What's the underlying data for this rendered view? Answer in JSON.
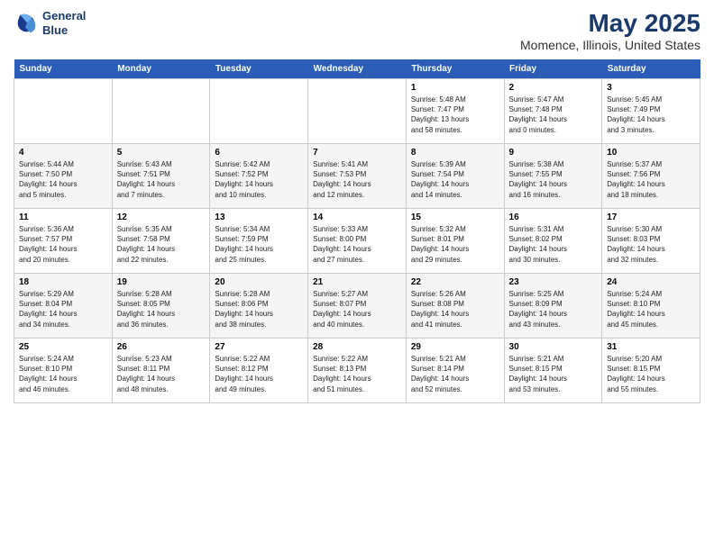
{
  "logo": {
    "line1": "General",
    "line2": "Blue"
  },
  "title": "May 2025",
  "subtitle": "Momence, Illinois, United States",
  "days_header": [
    "Sunday",
    "Monday",
    "Tuesday",
    "Wednesday",
    "Thursday",
    "Friday",
    "Saturday"
  ],
  "weeks": [
    [
      {
        "num": "",
        "info": ""
      },
      {
        "num": "",
        "info": ""
      },
      {
        "num": "",
        "info": ""
      },
      {
        "num": "",
        "info": ""
      },
      {
        "num": "1",
        "info": "Sunrise: 5:48 AM\nSunset: 7:47 PM\nDaylight: 13 hours\nand 58 minutes."
      },
      {
        "num": "2",
        "info": "Sunrise: 5:47 AM\nSunset: 7:48 PM\nDaylight: 14 hours\nand 0 minutes."
      },
      {
        "num": "3",
        "info": "Sunrise: 5:45 AM\nSunset: 7:49 PM\nDaylight: 14 hours\nand 3 minutes."
      }
    ],
    [
      {
        "num": "4",
        "info": "Sunrise: 5:44 AM\nSunset: 7:50 PM\nDaylight: 14 hours\nand 5 minutes."
      },
      {
        "num": "5",
        "info": "Sunrise: 5:43 AM\nSunset: 7:51 PM\nDaylight: 14 hours\nand 7 minutes."
      },
      {
        "num": "6",
        "info": "Sunrise: 5:42 AM\nSunset: 7:52 PM\nDaylight: 14 hours\nand 10 minutes."
      },
      {
        "num": "7",
        "info": "Sunrise: 5:41 AM\nSunset: 7:53 PM\nDaylight: 14 hours\nand 12 minutes."
      },
      {
        "num": "8",
        "info": "Sunrise: 5:39 AM\nSunset: 7:54 PM\nDaylight: 14 hours\nand 14 minutes."
      },
      {
        "num": "9",
        "info": "Sunrise: 5:38 AM\nSunset: 7:55 PM\nDaylight: 14 hours\nand 16 minutes."
      },
      {
        "num": "10",
        "info": "Sunrise: 5:37 AM\nSunset: 7:56 PM\nDaylight: 14 hours\nand 18 minutes."
      }
    ],
    [
      {
        "num": "11",
        "info": "Sunrise: 5:36 AM\nSunset: 7:57 PM\nDaylight: 14 hours\nand 20 minutes."
      },
      {
        "num": "12",
        "info": "Sunrise: 5:35 AM\nSunset: 7:58 PM\nDaylight: 14 hours\nand 22 minutes."
      },
      {
        "num": "13",
        "info": "Sunrise: 5:34 AM\nSunset: 7:59 PM\nDaylight: 14 hours\nand 25 minutes."
      },
      {
        "num": "14",
        "info": "Sunrise: 5:33 AM\nSunset: 8:00 PM\nDaylight: 14 hours\nand 27 minutes."
      },
      {
        "num": "15",
        "info": "Sunrise: 5:32 AM\nSunset: 8:01 PM\nDaylight: 14 hours\nand 29 minutes."
      },
      {
        "num": "16",
        "info": "Sunrise: 5:31 AM\nSunset: 8:02 PM\nDaylight: 14 hours\nand 30 minutes."
      },
      {
        "num": "17",
        "info": "Sunrise: 5:30 AM\nSunset: 8:03 PM\nDaylight: 14 hours\nand 32 minutes."
      }
    ],
    [
      {
        "num": "18",
        "info": "Sunrise: 5:29 AM\nSunset: 8:04 PM\nDaylight: 14 hours\nand 34 minutes."
      },
      {
        "num": "19",
        "info": "Sunrise: 5:28 AM\nSunset: 8:05 PM\nDaylight: 14 hours\nand 36 minutes."
      },
      {
        "num": "20",
        "info": "Sunrise: 5:28 AM\nSunset: 8:06 PM\nDaylight: 14 hours\nand 38 minutes."
      },
      {
        "num": "21",
        "info": "Sunrise: 5:27 AM\nSunset: 8:07 PM\nDaylight: 14 hours\nand 40 minutes."
      },
      {
        "num": "22",
        "info": "Sunrise: 5:26 AM\nSunset: 8:08 PM\nDaylight: 14 hours\nand 41 minutes."
      },
      {
        "num": "23",
        "info": "Sunrise: 5:25 AM\nSunset: 8:09 PM\nDaylight: 14 hours\nand 43 minutes."
      },
      {
        "num": "24",
        "info": "Sunrise: 5:24 AM\nSunset: 8:10 PM\nDaylight: 14 hours\nand 45 minutes."
      }
    ],
    [
      {
        "num": "25",
        "info": "Sunrise: 5:24 AM\nSunset: 8:10 PM\nDaylight: 14 hours\nand 46 minutes."
      },
      {
        "num": "26",
        "info": "Sunrise: 5:23 AM\nSunset: 8:11 PM\nDaylight: 14 hours\nand 48 minutes."
      },
      {
        "num": "27",
        "info": "Sunrise: 5:22 AM\nSunset: 8:12 PM\nDaylight: 14 hours\nand 49 minutes."
      },
      {
        "num": "28",
        "info": "Sunrise: 5:22 AM\nSunset: 8:13 PM\nDaylight: 14 hours\nand 51 minutes."
      },
      {
        "num": "29",
        "info": "Sunrise: 5:21 AM\nSunset: 8:14 PM\nDaylight: 14 hours\nand 52 minutes."
      },
      {
        "num": "30",
        "info": "Sunrise: 5:21 AM\nSunset: 8:15 PM\nDaylight: 14 hours\nand 53 minutes."
      },
      {
        "num": "31",
        "info": "Sunrise: 5:20 AM\nSunset: 8:15 PM\nDaylight: 14 hours\nand 55 minutes."
      }
    ]
  ]
}
